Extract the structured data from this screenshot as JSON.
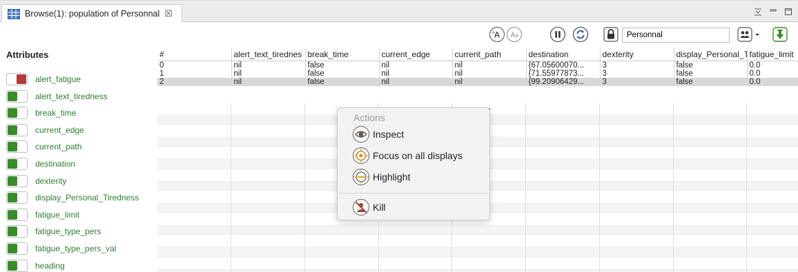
{
  "tab": {
    "title": "Browse(1): population of Personnal",
    "close_glyph": "☒"
  },
  "toolbar": {
    "search_value": "Personnal",
    "icons": [
      "increase-font-icon",
      "decrease-font-icon",
      "pause-icon",
      "refresh-icon",
      "lock-icon",
      "agents-menu-icon",
      "export-icon"
    ]
  },
  "attributes": {
    "title": "Attributes",
    "items": [
      {
        "label": "alert_fatigue",
        "on": false
      },
      {
        "label": "alert_text_tiredness",
        "on": true
      },
      {
        "label": "break_time",
        "on": true
      },
      {
        "label": "current_edge",
        "on": true
      },
      {
        "label": "current_path",
        "on": true
      },
      {
        "label": "destination",
        "on": true
      },
      {
        "label": "dexterity",
        "on": true
      },
      {
        "label": "display_Personal_Tiredness",
        "on": true
      },
      {
        "label": "fatigue_limit",
        "on": true
      },
      {
        "label": "fatigue_type_pers",
        "on": true
      },
      {
        "label": "fatigue_type_pers_val",
        "on": true
      },
      {
        "label": "heading",
        "on": true
      }
    ]
  },
  "table": {
    "columns": [
      "#",
      "alert_text_tirednes",
      "break_time",
      "current_edge",
      "current_path",
      "destination",
      "dexterity",
      "display_Personal_T",
      "fatigue_limit"
    ],
    "rows": [
      [
        "0",
        "nil",
        "false",
        "nil",
        "nil",
        "{67.05600070...",
        "3",
        "false",
        "0.0"
      ],
      [
        "1",
        "nil",
        "false",
        "nil",
        "nil",
        "{71.55977873...",
        "3",
        "false",
        "0.0"
      ],
      [
        "2",
        "nil",
        "false",
        "nil",
        "nil",
        "{99.20906429...",
        "3",
        "false",
        "0.0"
      ]
    ],
    "selected_row": 2
  },
  "context_menu": {
    "header": "Actions",
    "items": [
      {
        "label": "Inspect",
        "icon": "eye-icon"
      },
      {
        "label": "Focus on all displays",
        "icon": "target-icon"
      },
      {
        "label": "Highlight",
        "icon": "highlight-icon"
      },
      {
        "label": "Kill",
        "icon": "kill-icon"
      }
    ]
  },
  "colors": {
    "toggle_on": "#3a8c2a",
    "toggle_off": "#b13a3a",
    "attr_label": "#2e7d32",
    "selection": "#d8d8d8"
  }
}
